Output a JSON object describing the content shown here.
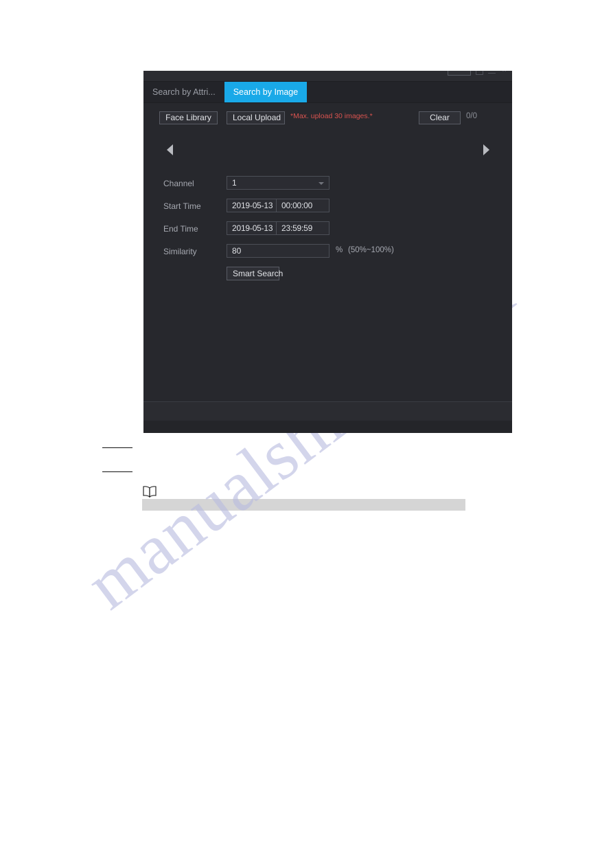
{
  "dialog": {
    "tabs": [
      {
        "label": "Search by Attri...",
        "active": false,
        "name": "tab-search-by-attribute"
      },
      {
        "label": "Search by Image",
        "active": true,
        "name": "tab-search-by-image"
      }
    ],
    "toolbar": {
      "face_library_label": "Face Library",
      "local_upload_label": "Local Upload",
      "warning_text": "*Max. upload 30 images.*",
      "clear_label": "Clear",
      "counter": "0/0"
    },
    "gallery": {
      "prev_icon": "triangle-left-icon",
      "next_icon": "triangle-right-icon"
    },
    "form": {
      "channel": {
        "label": "Channel",
        "value": "1",
        "caret_icon": "chevron-down-icon"
      },
      "start_time": {
        "label": "Start Time",
        "date": "2019-05-13",
        "time": "00:00:00"
      },
      "end_time": {
        "label": "End Time",
        "date": "2019-05-13",
        "time": "23:59:59"
      },
      "similarity": {
        "label": "Similarity",
        "value": "80",
        "unit": "%",
        "range_hint": "(50%~100%)"
      },
      "smart_search_label": "Smart Search"
    },
    "window_controls": {
      "restore_icon": "restore-icon",
      "minimize_icon": "minimize-icon",
      "maximize_icon": "maximize-icon",
      "close_icon": "close-icon"
    }
  },
  "page": {
    "note_icon": "open-book-icon",
    "watermark_text": "manualshive.com"
  },
  "colors": {
    "accent_blue": "#19a9e8",
    "warning_red": "#d9534f",
    "panel_bg": "#27282d",
    "titlebar_bg": "#2b2c31",
    "gray_bar": "#d5d5d5",
    "watermark": "#b9bce0"
  }
}
